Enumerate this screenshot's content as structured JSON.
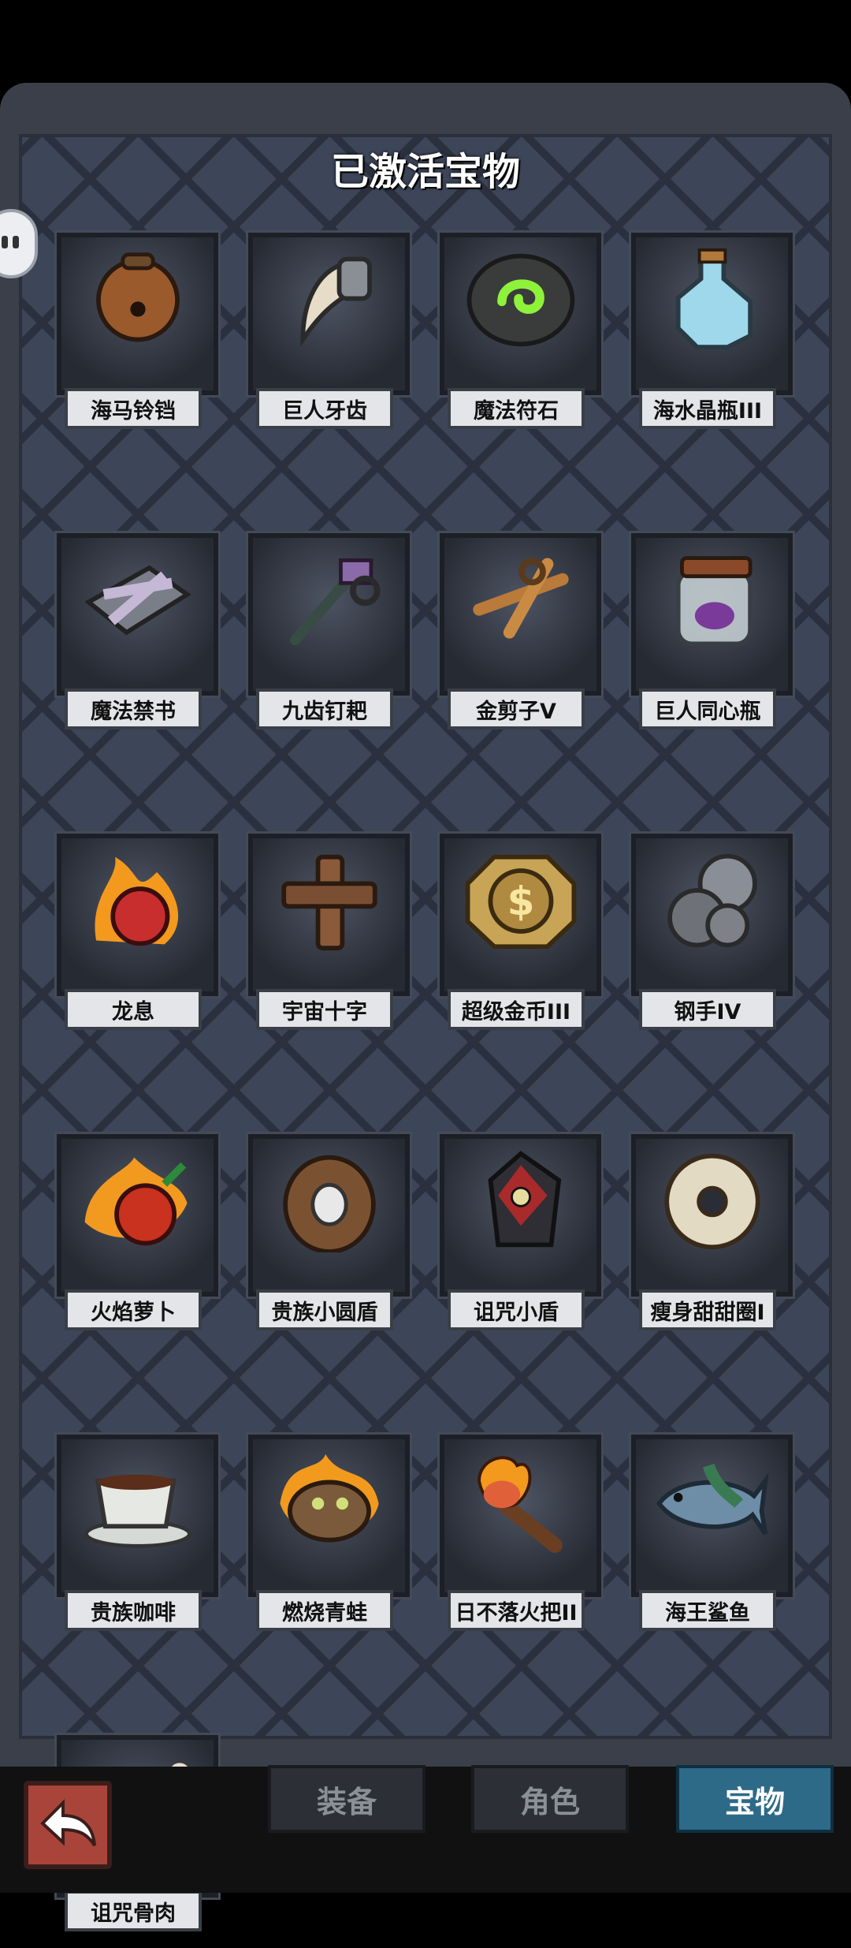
{
  "title": "已激活宝物",
  "items": [
    {
      "name": "海马铃铛",
      "icon": "bell-icon"
    },
    {
      "name": "巨人牙齿",
      "icon": "fang-icon"
    },
    {
      "name": "魔法符石",
      "icon": "rune-stone-icon"
    },
    {
      "name": "海水晶瓶III",
      "icon": "crystal-bottle-icon"
    },
    {
      "name": "魔法禁书",
      "icon": "forbidden-book-icon"
    },
    {
      "name": "九齿钉耙",
      "icon": "rake-icon"
    },
    {
      "name": "金剪子V",
      "icon": "scissors-icon"
    },
    {
      "name": "巨人同心瓶",
      "icon": "jar-icon"
    },
    {
      "name": "龙息",
      "icon": "dragon-breath-icon"
    },
    {
      "name": "宇宙十字",
      "icon": "cross-icon"
    },
    {
      "name": "超级金币III",
      "icon": "gold-coin-icon"
    },
    {
      "name": "钢手IV",
      "icon": "steel-fist-icon"
    },
    {
      "name": "火焰萝卜",
      "icon": "fire-radish-icon"
    },
    {
      "name": "贵族小圆盾",
      "icon": "round-shield-icon"
    },
    {
      "name": "诅咒小盾",
      "icon": "cursed-shield-icon"
    },
    {
      "name": "瘦身甜甜圈I",
      "icon": "donut-icon"
    },
    {
      "name": "贵族咖啡",
      "icon": "coffee-cup-icon"
    },
    {
      "name": "燃烧青蛙",
      "icon": "burning-frog-icon"
    },
    {
      "name": "日不落火把II",
      "icon": "torch-icon"
    },
    {
      "name": "海王鲨鱼",
      "icon": "shark-icon"
    },
    {
      "name": "诅咒骨肉",
      "icon": "bone-meat-icon"
    }
  ],
  "tabs": [
    {
      "label": "装备",
      "active": false
    },
    {
      "label": "角色",
      "active": false
    },
    {
      "label": "宝物",
      "active": true
    }
  ],
  "back_icon": "back-arrow-icon"
}
